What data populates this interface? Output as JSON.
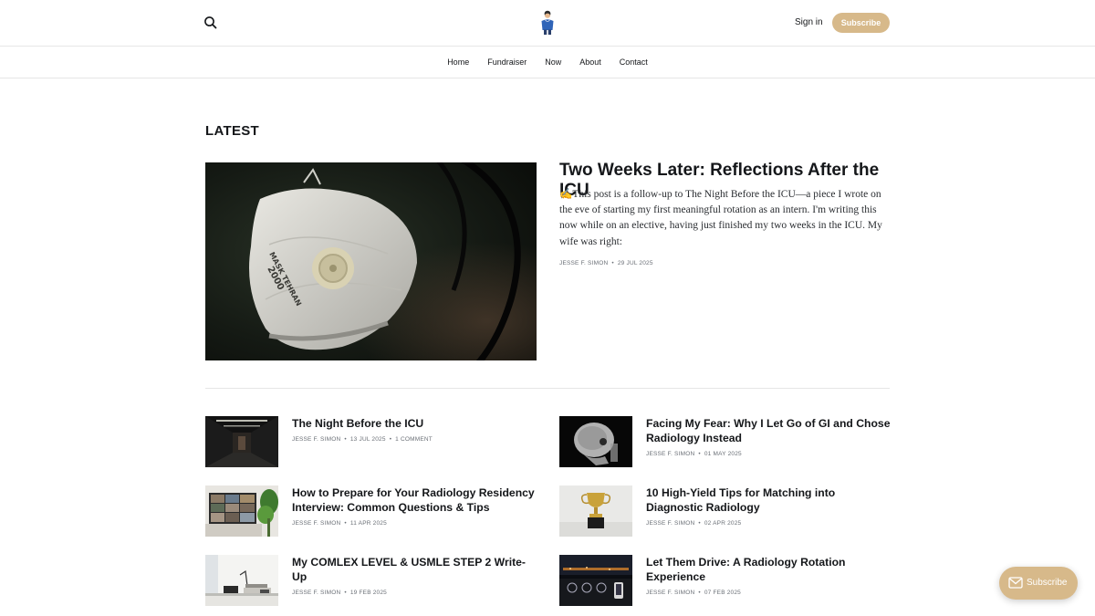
{
  "header": {
    "search_icon": "search-icon",
    "logo_icon": "doctor-avatar-icon",
    "sign_in_label": "Sign in",
    "subscribe_label": "Subscribe"
  },
  "nav": {
    "items": [
      {
        "label": "Home"
      },
      {
        "label": "Fundraiser"
      },
      {
        "label": "Now"
      },
      {
        "label": "About"
      },
      {
        "label": "Contact"
      }
    ]
  },
  "latest": {
    "heading": "LATEST",
    "featured": {
      "title": "Two Weeks Later: Reflections After the ICU",
      "excerpt": "✍️This post is a follow-up to The Night Before the ICU—a piece I wrote on the eve of starting my first meaningful rotation as an intern. I'm writing this now while on an elective, having just finished my two weeks in the ICU. My wife was right:",
      "author": "JESSE F. SIMON",
      "date": "29 JUL 2025",
      "image_text_1": "MASK TEHRAN",
      "image_text_2": "2000"
    },
    "posts": [
      {
        "title": "The Night Before the ICU",
        "author": "JESSE F. SIMON",
        "date": "13 JUL 2025",
        "comments": "1 COMMENT"
      },
      {
        "title": "Facing My Fear: Why I Let Go of GI and Chose Radiology Instead",
        "author": "JESSE F. SIMON",
        "date": "01 MAY 2025"
      },
      {
        "title": "How to Prepare for Your Radiology Residency Interview: Common Questions & Tips",
        "author": "JESSE F. SIMON",
        "date": "11 APR 2025"
      },
      {
        "title": "10 High-Yield Tips for Matching into Diagnostic Radiology",
        "author": "JESSE F. SIMON",
        "date": "02 APR 2025"
      },
      {
        "title": "My COMLEX LEVEL & USMLE STEP 2 Write-Up",
        "author": "JESSE F. SIMON",
        "date": "19 FEB 2025"
      },
      {
        "title": "Let Them Drive: A Radiology Rotation Experience",
        "author": "JESSE F. SIMON",
        "date": "07 FEB 2025"
      }
    ]
  },
  "portal": {
    "label": "Subscribe",
    "icon": "mail-icon"
  },
  "colors": {
    "accent": "#d7b98a",
    "text": "#15171a",
    "meta": "#6a6f76",
    "border": "#e6e6e6"
  }
}
